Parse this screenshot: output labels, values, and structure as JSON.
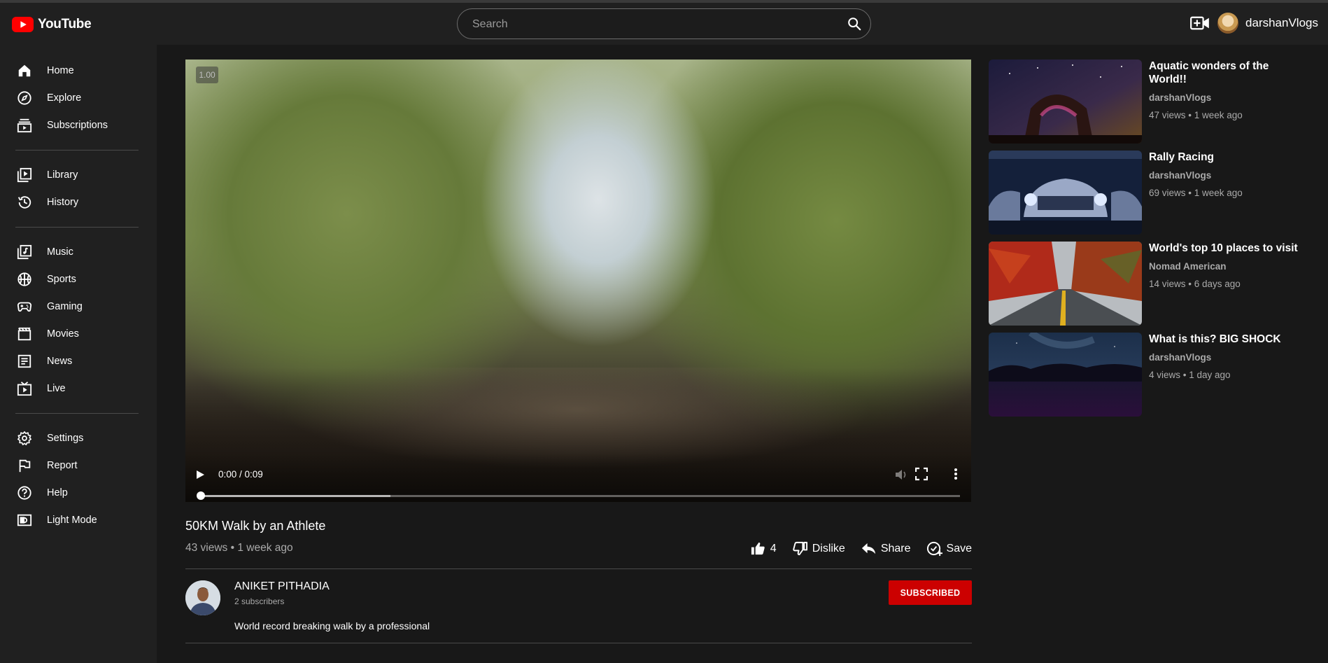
{
  "header": {
    "logo_text": "YouTube",
    "search_placeholder": "Search",
    "username": "darshanVlogs"
  },
  "sidebar": {
    "items": [
      {
        "label": "Home",
        "icon": "home-icon"
      },
      {
        "label": "Explore",
        "icon": "compass-icon"
      },
      {
        "label": "Subscriptions",
        "icon": "subscriptions-icon"
      },
      {
        "label": "Library",
        "icon": "library-icon"
      },
      {
        "label": "History",
        "icon": "history-icon"
      },
      {
        "label": "Music",
        "icon": "music-icon"
      },
      {
        "label": "Sports",
        "icon": "sports-icon"
      },
      {
        "label": "Gaming",
        "icon": "gaming-icon"
      },
      {
        "label": "Movies",
        "icon": "movies-icon"
      },
      {
        "label": "News",
        "icon": "news-icon"
      },
      {
        "label": "Live",
        "icon": "live-icon"
      },
      {
        "label": "Settings",
        "icon": "gear-icon"
      },
      {
        "label": "Report",
        "icon": "flag-icon"
      },
      {
        "label": "Help",
        "icon": "help-icon"
      },
      {
        "label": "Light Mode",
        "icon": "light-mode-icon"
      }
    ]
  },
  "player": {
    "speed": "1.00",
    "time": "0:00 / 0:09",
    "progress": 0,
    "buffered": 0.25
  },
  "video": {
    "title": "50KM Walk by an Athlete",
    "meta": "43 views • 1 week ago",
    "likes": "4",
    "dislike_label": "Dislike",
    "share_label": "Share",
    "save_label": "Save"
  },
  "channel": {
    "name": "ANIKET PITHADIA",
    "subscribers": "2 subscribers",
    "description": "World record breaking walk by a professional",
    "subscribe_label": "SUBSCRIBED"
  },
  "suggestions": [
    {
      "title": "Aquatic wonders of the World!!",
      "channel": "darshanVlogs",
      "meta": "47 views • 1 week ago"
    },
    {
      "title": "Rally Racing",
      "channel": "darshanVlogs",
      "meta": "69 views • 1 week ago"
    },
    {
      "title": "World's top 10 places to visit",
      "channel": "Nomad American",
      "meta": "14 views • 6 days ago"
    },
    {
      "title": "What is this? BIG SHOCK",
      "channel": "darshanVlogs",
      "meta": "4 views • 1 day ago"
    }
  ],
  "colors": {
    "accent": "#ff0000",
    "subscribe": "#cc0000",
    "background": "#181818",
    "panel": "#202020"
  }
}
